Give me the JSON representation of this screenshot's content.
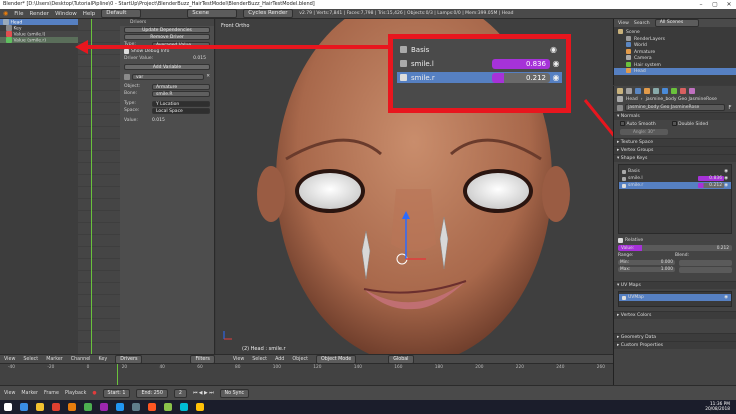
{
  "window": {
    "title": "Blender* [D:\\Users\\Desktop\\TutorialPipline\\0 - StartUp\\Project\\BlenderBuzz_HairTestModel\\BlenderBuzz_HairTestModel.blend]"
  },
  "infobar": {
    "menus": [
      "File",
      "Render",
      "Window",
      "Help"
    ],
    "layout": "Default",
    "scene": "Scene",
    "engine": "Cycles Render",
    "stats": "v2.79 | Verts:7,841 | Faces:7,798 | Tris:15,426 | Objects:0/3 | Lamps:0/0 | Mem:399.05M | Head"
  },
  "graph_editor": {
    "channels": [
      {
        "label": "Head",
        "color": "#3f8fd6",
        "selected": true
      },
      {
        "label": "Key",
        "color": "#9c9c9c",
        "selected": false
      },
      {
        "label": "Value (smile.l)",
        "color": "#e05050",
        "selected": false
      },
      {
        "label": "Value (smile.r)",
        "color": "#60c060",
        "selected": true
      }
    ]
  },
  "drivers_panel": {
    "title": "Drivers",
    "update_button": "Update Dependencies",
    "remove_button": "Remove Driver",
    "type_label": "Type:",
    "type_value": "Averaged Value",
    "debug_label": "Show Debug Info",
    "driver_value_label": "Driver Value:",
    "driver_value": "0.015",
    "add_variable": "Add Variable",
    "variable_name": "var",
    "object_label": "Object:",
    "object_value": "Armature",
    "bone_label": "Bone:",
    "bone_value": "smile.R",
    "vtype_label": "Type:",
    "vtype_value": "Y Location",
    "space_label": "Space:",
    "space_value": "Local Space",
    "value_label": "Value:",
    "value": "0.015"
  },
  "viewport": {
    "view_label": "Front Ortho",
    "object_label": "(2) Head : smile.r"
  },
  "callout": {
    "rows": [
      {
        "label": "Basis",
        "value": "",
        "bar_fraction": 0,
        "color": ""
      },
      {
        "label": "smile.l",
        "value": "0.836",
        "bar_fraction": 0.836,
        "color": "#a632d8"
      },
      {
        "label": "smile.r",
        "value": "0.212",
        "bar_fraction": 0.212,
        "color": "#a632d8"
      }
    ]
  },
  "outliner": {
    "header": [
      "View",
      "Search",
      "All Scenes"
    ],
    "items": [
      {
        "label": "Scene",
        "indent": 0
      },
      {
        "label": "RenderLayers",
        "indent": 1
      },
      {
        "label": "World",
        "indent": 1
      },
      {
        "label": "Armature",
        "indent": 1
      },
      {
        "label": "Camera",
        "indent": 1
      },
      {
        "label": "Hair system",
        "indent": 1
      },
      {
        "label": "Head",
        "indent": 1
      }
    ]
  },
  "properties": {
    "object_name": "Head",
    "mesh_name": "jasmine_body Geo JasmineRose",
    "mesh_field": "jasmine_body Geo JasmineRose",
    "sections": [
      "Normals",
      "Texture Space",
      "Vertex Groups",
      "Shape Keys"
    ],
    "normals": {
      "auto_smooth": "Auto Smooth",
      "double_sided": "Double Sided",
      "angle": "Angle: 30°"
    },
    "shape_keys": [
      {
        "label": "Basis",
        "value": ""
      },
      {
        "label": "smile.l",
        "value": "0.836"
      },
      {
        "label": "smile.r",
        "value": "0.212"
      }
    ],
    "relative": "Relative",
    "value_label": "Value:",
    "value": "0.212",
    "range_label": "Range:",
    "blend_label": "Blend:",
    "min_label": "Min:",
    "min_value": "0.000",
    "max_label": "Max:",
    "max_value": "1.000",
    "uv_maps_title": "UV Maps",
    "uv_map": "UVMap",
    "vertex_colors": "Vertex Colors",
    "geometry_data": "Geometry Data",
    "custom_properties": "Custom Properties"
  },
  "graph_header": {
    "items": [
      "View",
      "Select",
      "Marker",
      "Channel",
      "Key"
    ],
    "mode": "Drivers",
    "filters": "Filters"
  },
  "viewport_header": {
    "items": [
      "View",
      "Select",
      "Add",
      "Object"
    ],
    "mode": "Object Mode",
    "orientation": "Global"
  },
  "timeline_header": {
    "items": [
      "View",
      "Marker",
      "Frame",
      "Playback"
    ],
    "start_label": "Start:",
    "start": "1",
    "end_label": "End:",
    "end": "250",
    "current": "2",
    "sync": "No Sync",
    "ticks": [
      "-40",
      "-20",
      "0",
      "20",
      "40",
      "60",
      "80",
      "100",
      "120",
      "140",
      "160",
      "180",
      "200",
      "220",
      "240",
      "260"
    ]
  },
  "taskbar": {
    "time": "11:36 PM",
    "date": "20/08/2018"
  }
}
